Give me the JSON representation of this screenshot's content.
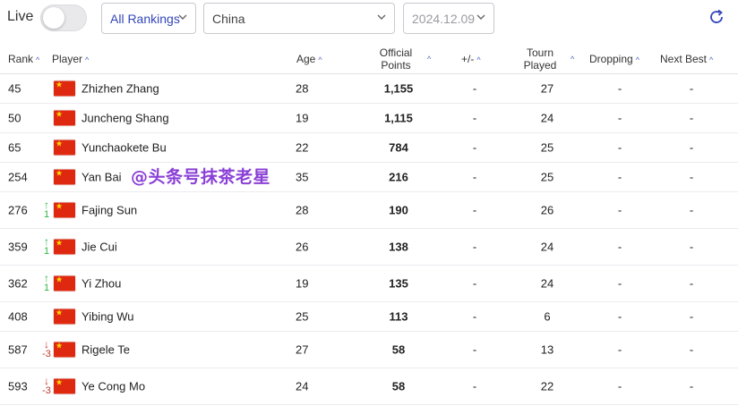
{
  "topbar": {
    "live_label": "Live",
    "live_on": false,
    "ranking_select": "All Rankings",
    "country_select": "China",
    "date_select": "2024.12.09"
  },
  "table": {
    "headers": {
      "rank": "Rank",
      "player": "Player",
      "age": "Age",
      "points_line1": "Official",
      "points_line2": "Points",
      "diff": "+/-",
      "tourn_line1": "Tourn",
      "tourn_line2": "Played",
      "dropping": "Dropping",
      "next_best": "Next Best"
    },
    "rows": [
      {
        "rank": "45",
        "move_dir": "",
        "move_val": "",
        "player": "Zhizhen Zhang",
        "age": "28",
        "points": "1,155",
        "diff": "-",
        "tourn": "27",
        "dropping": "-",
        "next_best": "-"
      },
      {
        "rank": "50",
        "move_dir": "",
        "move_val": "",
        "player": "Juncheng Shang",
        "age": "19",
        "points": "1,115",
        "diff": "-",
        "tourn": "24",
        "dropping": "-",
        "next_best": "-"
      },
      {
        "rank": "65",
        "move_dir": "",
        "move_val": "",
        "player": "Yunchaokete Bu",
        "age": "22",
        "points": "784",
        "diff": "-",
        "tourn": "25",
        "dropping": "-",
        "next_best": "-"
      },
      {
        "rank": "254",
        "move_dir": "",
        "move_val": "",
        "player": "Yan Bai",
        "age": "35",
        "points": "216",
        "diff": "-",
        "tourn": "25",
        "dropping": "-",
        "next_best": "-"
      },
      {
        "rank": "276",
        "move_dir": "up",
        "move_val": "1",
        "player": "Fajing Sun",
        "age": "28",
        "points": "190",
        "diff": "-",
        "tourn": "26",
        "dropping": "-",
        "next_best": "-"
      },
      {
        "rank": "359",
        "move_dir": "up",
        "move_val": "1",
        "player": "Jie Cui",
        "age": "26",
        "points": "138",
        "diff": "-",
        "tourn": "24",
        "dropping": "-",
        "next_best": "-"
      },
      {
        "rank": "362",
        "move_dir": "up",
        "move_val": "1",
        "player": "Yi Zhou",
        "age": "19",
        "points": "135",
        "diff": "-",
        "tourn": "24",
        "dropping": "-",
        "next_best": "-"
      },
      {
        "rank": "408",
        "move_dir": "",
        "move_val": "",
        "player": "Yibing Wu",
        "age": "25",
        "points": "113",
        "diff": "-",
        "tourn": "6",
        "dropping": "-",
        "next_best": "-"
      },
      {
        "rank": "587",
        "move_dir": "down",
        "move_val": "-3",
        "player": "Rigele Te",
        "age": "27",
        "points": "58",
        "diff": "-",
        "tourn": "13",
        "dropping": "-",
        "next_best": "-"
      },
      {
        "rank": "593",
        "move_dir": "down",
        "move_val": "-3",
        "player": "Ye Cong Mo",
        "age": "24",
        "points": "58",
        "diff": "-",
        "tourn": "22",
        "dropping": "-",
        "next_best": "-"
      }
    ]
  },
  "watermark": "@头条号抹茶老星",
  "icons": {
    "flag": "china-flag-icon",
    "sort": "sort-asc-icon",
    "refresh": "refresh-icon",
    "chevron": "chevron-down-icon"
  },
  "colors": {
    "accent": "#3346b9",
    "up": "#2fb344",
    "down": "#c0392b",
    "flag_red": "#de2910",
    "flag_star": "#ffde00",
    "watermark": "#8a3fd6"
  }
}
